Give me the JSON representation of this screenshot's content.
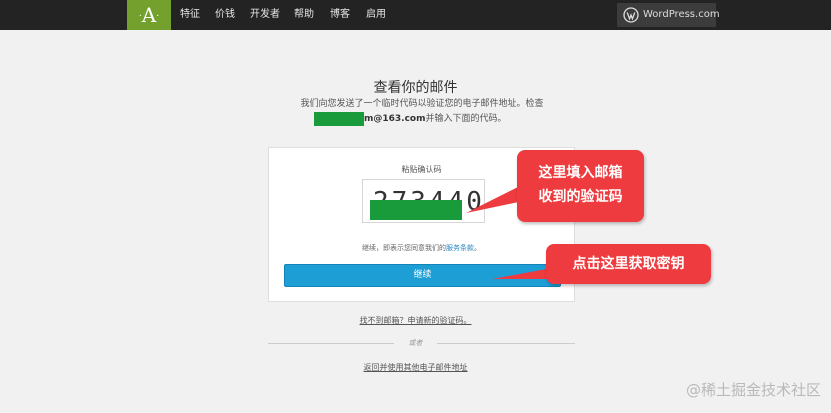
{
  "nav": {
    "logo": "A",
    "items": [
      {
        "label": "特征"
      },
      {
        "label": "价钱"
      },
      {
        "label": "开发者"
      },
      {
        "label": "帮助"
      },
      {
        "label": "博客"
      },
      {
        "label": "启用"
      }
    ],
    "wordpress_button": {
      "label": "WordPress.com",
      "icon": "wordpress-icon"
    }
  },
  "main": {
    "title": "查看你的邮件",
    "subtitle": "我们向您发送了一个临时代码以验证您的电子邮件地址。检查",
    "email_visible": "m@163.com",
    "email_suffix": "并输入下面的代码。"
  },
  "card": {
    "label": "粘贴确认码",
    "code_value": "273440",
    "terms_prefix": "继续，即表示您同意我们的",
    "terms_link": "服务条款",
    "terms_suffix": "。",
    "continue_label": "继续"
  },
  "footer": {
    "resend_link": "找不到邮箱？申请新的验证码。",
    "or_text": "或者",
    "change_email_link": "返回并使用其他电子邮件地址"
  },
  "annotations": {
    "callout_code_line1": "这里填入邮箱",
    "callout_code_line2": "收到的验证码",
    "callout_button": "点击这里获取密钥"
  },
  "watermark": "@稀土掘金技术社区",
  "colors": {
    "topbar": "#232323",
    "logo_bg": "#74a12e",
    "button_blue": "#1d9fd6",
    "callout_red": "#ee3b3f",
    "mask_green": "#1a9b3b"
  }
}
